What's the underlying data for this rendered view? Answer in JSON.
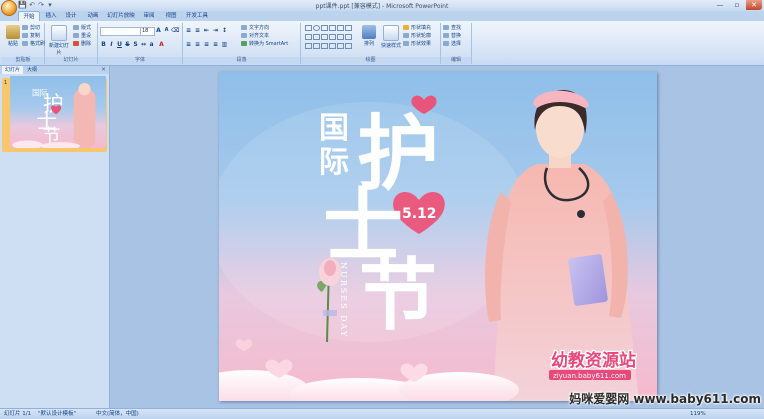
{
  "window": {
    "title": "ppt课件.ppt [兼容模式] - Microsoft PowerPoint",
    "min_label": "—",
    "max_label": "▫",
    "close_label": "✕"
  },
  "qat": {
    "save": "💾",
    "undo": "↶",
    "redo": "↷",
    "more": "▾"
  },
  "ribbon": {
    "tabs": [
      {
        "label": "开始",
        "active": true
      },
      {
        "label": "插入"
      },
      {
        "label": "设计"
      },
      {
        "label": "动画"
      },
      {
        "label": "幻灯片放映"
      },
      {
        "label": "审阅"
      },
      {
        "label": "视图"
      },
      {
        "label": "开发工具"
      }
    ],
    "groups": {
      "clipboard": {
        "label": "剪贴板",
        "paste": "粘贴",
        "cut": "剪切",
        "copy": "复制",
        "format_painter": "格式刷"
      },
      "slides": {
        "label": "幻灯片",
        "new_slide": "新建幻灯片",
        "layout": "版式",
        "reset": "重设",
        "delete": "删除"
      },
      "font": {
        "label": "字体",
        "font_name": "",
        "font_size": "18"
      },
      "paragraph": {
        "label": "段落",
        "text_direction": "文字方向",
        "align_text": "对齐文本",
        "smartart": "转换为 SmartArt"
      },
      "drawing": {
        "label": "绘图",
        "arrange": "排列",
        "quick_styles": "快速样式",
        "fill": "形状填充",
        "outline": "形状轮廓",
        "effects": "形状效果"
      },
      "editing": {
        "label": "编辑",
        "find": "查找",
        "replace": "替换",
        "select": "选择"
      }
    }
  },
  "panel": {
    "tabs": [
      "幻灯片",
      "大纲"
    ],
    "close": "×",
    "selected_slide_number": "1"
  },
  "slide": {
    "title_small": "国际",
    "title_big_1": "护",
    "title_big_2": "士",
    "title_big_3": "节",
    "date": "5.12",
    "vertical_text": "NURSES DAY",
    "logo_text": "幼教资源站",
    "logo_url": "ziyuan.baby611.com"
  },
  "status": {
    "slide_count": "幻灯片 1/1",
    "theme": "\"默认设计模板\"",
    "language": "中文(简体，中国)",
    "zoom": "119%"
  },
  "watermark": "妈咪爱婴网 www.baby611.com",
  "colors": {
    "accent_pink": "#e9557a",
    "ribbon_blue": "#15428b",
    "slide_sky": "#8fbfe9"
  }
}
